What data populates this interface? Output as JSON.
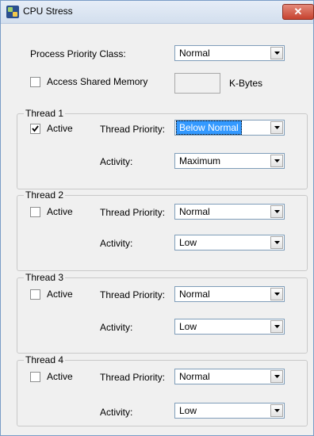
{
  "window": {
    "title": "CPU Stress",
    "close_label": "✕"
  },
  "process": {
    "priority_label": "Process Priority Class:",
    "priority_value": "Normal"
  },
  "shared_memory": {
    "label": "Access Shared Memory",
    "checked": false,
    "value": "",
    "unit": "K-Bytes"
  },
  "threads": [
    {
      "title": "Thread 1",
      "active_label": "Active",
      "active": true,
      "priority_label": "Thread Priority:",
      "priority_value": "Below Normal",
      "activity_label": "Activity:",
      "activity_value": "Maximum"
    },
    {
      "title": "Thread 2",
      "active_label": "Active",
      "active": false,
      "priority_label": "Thread Priority:",
      "priority_value": "Normal",
      "activity_label": "Activity:",
      "activity_value": "Low"
    },
    {
      "title": "Thread 3",
      "active_label": "Active",
      "active": false,
      "priority_label": "Thread Priority:",
      "priority_value": "Normal",
      "activity_label": "Activity:",
      "activity_value": "Low"
    },
    {
      "title": "Thread 4",
      "active_label": "Active",
      "active": false,
      "priority_label": "Thread Priority:",
      "priority_value": "Normal",
      "activity_label": "Activity:",
      "activity_value": "Low"
    }
  ]
}
